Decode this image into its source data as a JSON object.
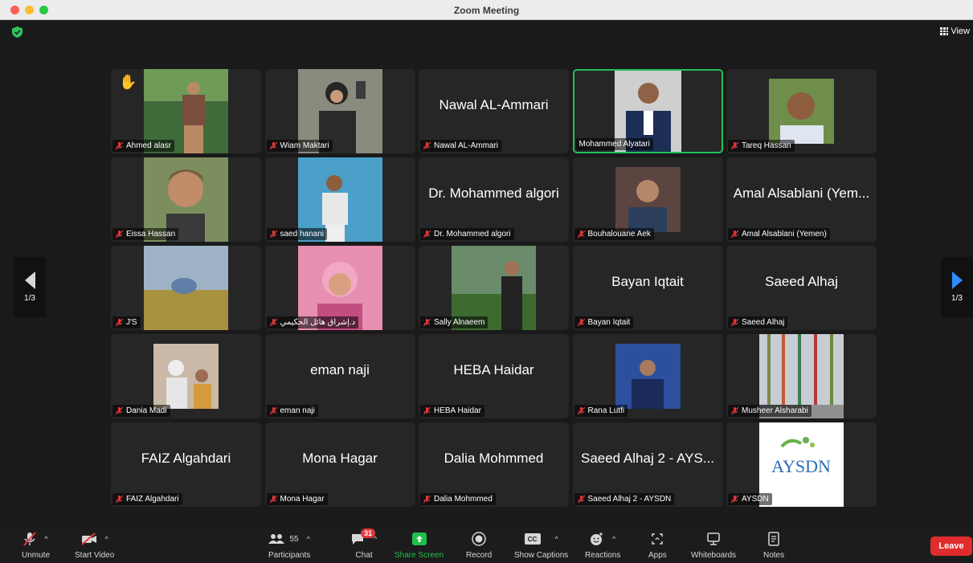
{
  "window": {
    "title": "Zoom Meeting"
  },
  "top": {
    "view_label": "View"
  },
  "pager": {
    "page_left": "1/3",
    "page_right": "1/3"
  },
  "tiles": [
    {
      "name": "Ahmed alasr",
      "big": "",
      "hand": "✋"
    },
    {
      "name": "Wiam Maktari",
      "big": ""
    },
    {
      "name": "Nawal AL-Ammari",
      "big": "Nawal AL-Ammari"
    },
    {
      "name": "Mohammed Alyatari",
      "big": ""
    },
    {
      "name": "Tareq Hassan",
      "big": ""
    },
    {
      "name": "Eissa Hassan",
      "big": ""
    },
    {
      "name": "saed hanani",
      "big": ""
    },
    {
      "name": "Dr. Mohammed algori",
      "big": "Dr. Mohammed algori"
    },
    {
      "name": "Bouhalouane Aek",
      "big": ""
    },
    {
      "name": "Amal Alsablani (Yemen)",
      "big": "Amal Alsablani (Yem..."
    },
    {
      "name": "J'S",
      "big": ""
    },
    {
      "name": "د.إشراق هائل الحكيمي",
      "big": ""
    },
    {
      "name": "Sally Alnaeem",
      "big": ""
    },
    {
      "name": "Bayan Iqtait",
      "big": "Bayan Iqtait"
    },
    {
      "name": "Saeed Alhaj",
      "big": "Saeed Alhaj"
    },
    {
      "name": "Dania Madi",
      "big": ""
    },
    {
      "name": "eman naji",
      "big": "eman naji"
    },
    {
      "name": "HEBA Haidar",
      "big": "HEBA Haidar"
    },
    {
      "name": "Rana Lutfi",
      "big": ""
    },
    {
      "name": "Musheer Alsharabi",
      "big": ""
    },
    {
      "name": "FAIZ Algahdari",
      "big": "FAIZ Algahdari"
    },
    {
      "name": "Mona Hagar",
      "big": "Mona Hagar"
    },
    {
      "name": "Dalia Mohmmed",
      "big": "Dalia Mohmmed"
    },
    {
      "name": "Saeed Alhaj 2 - AYSDN",
      "big": "Saeed Alhaj 2 - AYS..."
    },
    {
      "name": "AYSDN",
      "big": "",
      "logo_text": "AYSDN"
    }
  ],
  "toolbar": {
    "unmute": "Unmute",
    "start_video": "Start Video",
    "participants": "Participants",
    "participants_count": "55",
    "chat": "Chat",
    "chat_badge": "31",
    "share_screen": "Share Screen",
    "record": "Record",
    "show_captions": "Show Captions",
    "captions_icon": "CC",
    "reactions": "Reactions",
    "apps": "Apps",
    "whiteboards": "Whiteboards",
    "notes": "Notes",
    "leave": "Leave"
  },
  "colors": {
    "active_border": "#22c05a",
    "leave": "#e02c2c",
    "share": "#1fbf4d",
    "mute_red": "#e5383b"
  }
}
